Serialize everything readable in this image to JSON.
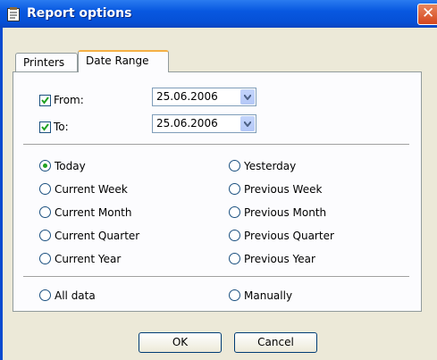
{
  "window": {
    "title": "Report options"
  },
  "tabs": [
    {
      "label": "Printers",
      "active": false
    },
    {
      "label": "Date Range",
      "active": true
    }
  ],
  "from": {
    "label": "From:",
    "checked": true,
    "value": "25.06.2006"
  },
  "to": {
    "label": "To:",
    "checked": true,
    "value": "25.06.2006"
  },
  "radios": {
    "today": {
      "label": "Today",
      "selected": true
    },
    "yesterday": {
      "label": "Yesterday",
      "selected": false
    },
    "current_week": {
      "label": "Current Week",
      "selected": false
    },
    "previous_week": {
      "label": "Previous Week",
      "selected": false
    },
    "current_month": {
      "label": "Current Month",
      "selected": false
    },
    "previous_month": {
      "label": "Previous Month",
      "selected": false
    },
    "current_quarter": {
      "label": "Current Quarter",
      "selected": false
    },
    "previous_quarter": {
      "label": "Previous Quarter",
      "selected": false
    },
    "current_year": {
      "label": "Current Year",
      "selected": false
    },
    "previous_year": {
      "label": "Previous Year",
      "selected": false
    },
    "all_data": {
      "label": "All data",
      "selected": false
    },
    "manually": {
      "label": "Manually",
      "selected": false
    }
  },
  "buttons": {
    "ok": "OK",
    "cancel": "Cancel"
  },
  "colors": {
    "titlebar": "#0858e0",
    "face": "#ece9d8",
    "tab_highlight": "#f5b045",
    "radio_dot": "#21a121"
  },
  "icons": {
    "title": "report-icon",
    "close": "close-icon",
    "dropdown": "chevron-down-icon"
  }
}
